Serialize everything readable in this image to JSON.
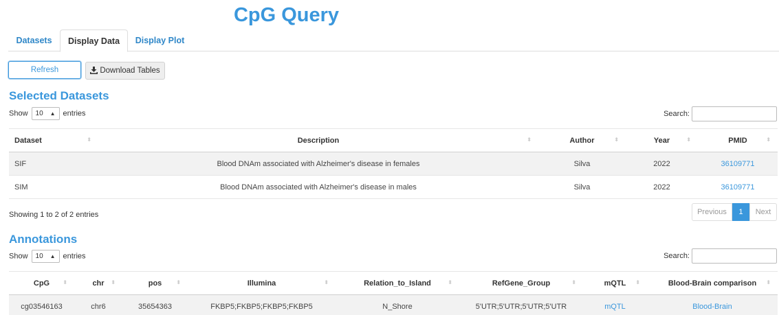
{
  "app": {
    "title": "CpG Query"
  },
  "tabs": [
    {
      "label": "Datasets",
      "active": false
    },
    {
      "label": "Display Data",
      "active": true
    },
    {
      "label": "Display Plot",
      "active": false
    }
  ],
  "buttons": {
    "refresh": "Refresh",
    "download": "Download Tables",
    "download_icon": "download-icon"
  },
  "colors": {
    "accent": "#3a97dc",
    "link": "#3a97dc",
    "stripe": "#f2f2f2"
  },
  "selected": {
    "title": "Selected Datasets",
    "show_prefix": "Show",
    "entries_value": "10",
    "show_suffix": "entries",
    "search_label": "Search:",
    "columns": [
      "Dataset",
      "Description",
      "Author",
      "Year",
      "PMID"
    ],
    "rows": [
      [
        "SIF",
        "Blood DNAm associated with Alzheimer's disease in females",
        "Silva",
        "2022",
        "36109771"
      ],
      [
        "SIM",
        "Blood DNAm associated with Alzheimer's disease in males",
        "Silva",
        "2022",
        "36109771"
      ]
    ],
    "info": "Showing 1 to 2 of 2 entries",
    "pagination": {
      "previous": "Previous",
      "current": "1",
      "next": "Next"
    }
  },
  "annotations": {
    "title": "Annotations",
    "show_prefix": "Show",
    "entries_value": "10",
    "show_suffix": "entries",
    "search_label": "Search:",
    "columns": [
      "CpG",
      "chr",
      "pos",
      "Illumina",
      "Relation_to_Island",
      "RefGene_Group",
      "mQTL",
      "Blood-Brain comparison"
    ],
    "rows": [
      [
        "cg03546163",
        "chr6",
        "35654363",
        "FKBP5;FKBP5;FKBP5;FKBP5",
        "N_Shore",
        "5'UTR;5'UTR;5'UTR;5'UTR",
        "mQTL",
        "Blood-Brain"
      ]
    ]
  }
}
